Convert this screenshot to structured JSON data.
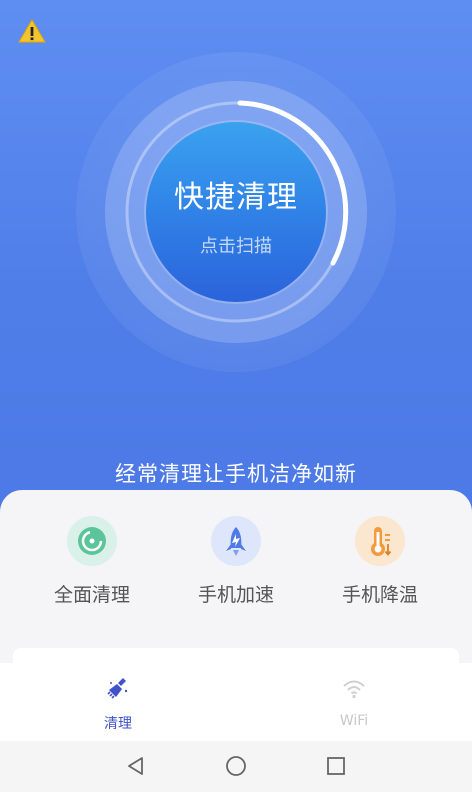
{
  "header": {
    "warning_icon": "warning-triangle-icon"
  },
  "scan": {
    "title": "快捷清理",
    "subtitle": "点击扫描"
  },
  "slogan": "经常清理让手机洁净如新",
  "features": [
    {
      "label": "全面清理",
      "icon": "clean-gauge-icon",
      "color": "#59c49a"
    },
    {
      "label": "手机加速",
      "icon": "rocket-icon",
      "color": "#4f7ae8"
    },
    {
      "label": "手机降温",
      "icon": "thermometer-icon",
      "color": "#f29a3c"
    }
  ],
  "tabbar": {
    "tabs": [
      {
        "label": "清理",
        "icon": "broom-icon",
        "active": true
      },
      {
        "label": "WiFi",
        "icon": "wifi-icon",
        "active": false
      }
    ]
  },
  "colors": {
    "accent": "#3f52c8",
    "hero_bg": "#5a88ef",
    "inactive": "#cfcfcf"
  }
}
